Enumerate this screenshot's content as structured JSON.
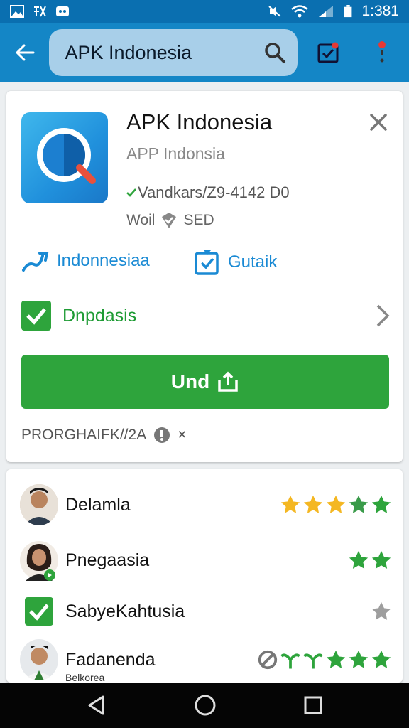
{
  "status_bar": {
    "time": "1:381"
  },
  "app_bar": {
    "search_text": "APK Indonesia"
  },
  "app_card": {
    "title": "APK Indonesia",
    "subtitle": "APP Indonsia",
    "meta_line1": "Vandkars/Z9-4142 D0",
    "meta_line2_a": "Woil",
    "meta_line2_b": "SED",
    "tag1_label": "Indonnesiaa",
    "tag2_label": "Gutaik",
    "download_row_label": "Dnpdasis",
    "install_label": "Und",
    "footer_text": "PRORGHAIFK//2A",
    "footer_close": "×"
  },
  "reviews": [
    {
      "name": "Delamla",
      "stars": "4.5 gold + green"
    },
    {
      "name": "Pnegaasia",
      "stars": "2 green"
    },
    {
      "name": "SabyeKahtusia",
      "stars": "1 grey"
    },
    {
      "name": "Fadanenda",
      "sub": "Belkorea",
      "stars": "mixed"
    }
  ],
  "colors": {
    "status_bar": "#0a6fb0",
    "app_bar": "#1486c6",
    "accent_green": "#2ea43c",
    "link_blue": "#1a8ad4",
    "star_gold": "#f4b722"
  }
}
